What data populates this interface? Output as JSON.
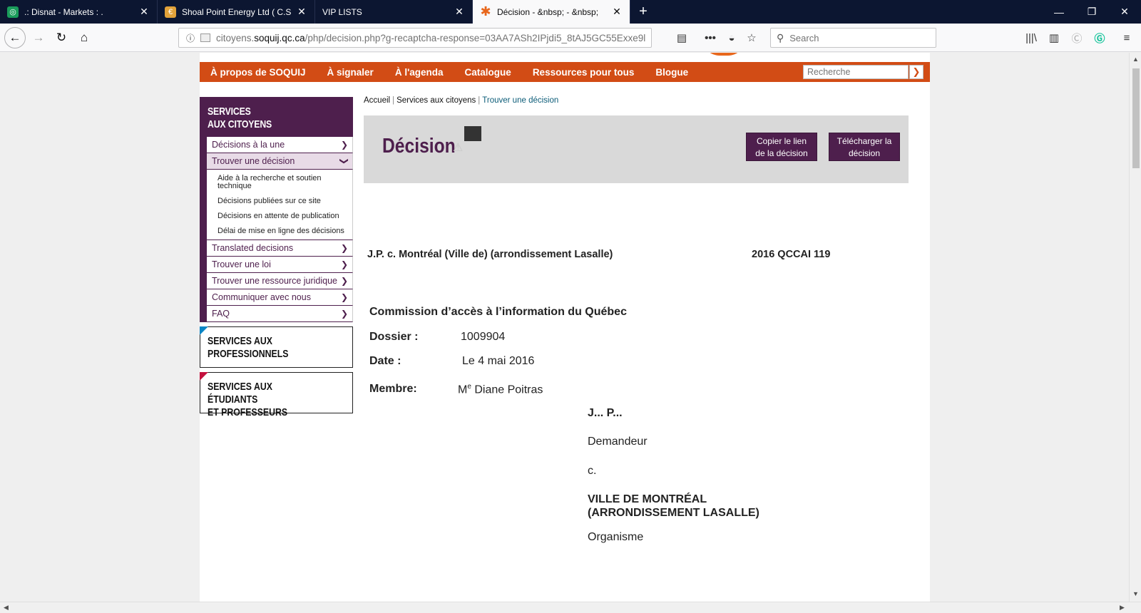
{
  "tabs": [
    {
      "title": ".: Disnat - Markets : .",
      "favicon_color": "#1a9c5b",
      "active": false
    },
    {
      "title": "Shoal Point Energy Ltd ( C.SHP",
      "favicon_color": "#e2a23a",
      "active": false
    },
    {
      "title": "VIP LISTS",
      "favicon_color": "",
      "active": false
    },
    {
      "title": "Décision - &nbsp; - &nbsp;",
      "favicon_color": "#e8671c",
      "active": true
    }
  ],
  "browser": {
    "url_domain": "citoyens.soquij.qc.ca",
    "url_pre": "citoyens.",
    "url_host": "soquij.qc.ca",
    "url_path": "/php/decision.php?g-recaptcha-response=03AA7ASh2IPjdi5_8tAJ5GC55Exxe9l",
    "search_placeholder": "Search"
  },
  "site": {
    "nav": [
      "À propos de SOQUIJ",
      "À signaler",
      "À l'agenda",
      "Catalogue",
      "Ressources pour tous",
      "Blogue"
    ],
    "search_placeholder": "Recherche",
    "accent_color": "#d24c15",
    "brand_color": "#4e1f4d"
  },
  "sidebar": {
    "heading_line1": "SERVICES",
    "heading_line2": "AUX CITOYENS",
    "items_top": [
      {
        "label": "Décisions à la une"
      },
      {
        "label": "Trouver une décision",
        "open": true
      }
    ],
    "subitems": [
      "Aide à la recherche et soutien technique",
      "Décisions publiées sur ce site",
      "Décisions en attente de publication",
      "Délai de mise en ligne des décisions"
    ],
    "items_bottom": [
      {
        "label": "Translated decisions"
      },
      {
        "label": "Trouver une loi"
      },
      {
        "label": "Trouver une ressource juridique"
      },
      {
        "label": "Communiquer avec nous"
      },
      {
        "label": "FAQ"
      }
    ],
    "box_pro_line1": "SERVICES AUX",
    "box_pro_line2": "PROFESSIONNELS",
    "box_etu_line1": "SERVICES AUX ÉTUDIANTS",
    "box_etu_line2": "ET PROFESSEURS"
  },
  "breadcrumb": {
    "home": "Accueil",
    "section": "Services aux citoyens",
    "current": "Trouver une décision"
  },
  "decision": {
    "title": "Décision",
    "copy_line1": "Copier le lien",
    "copy_line2": "de la décision",
    "download_line1": "Télécharger la",
    "download_line2": "décision",
    "case_name": "J.P. c. Montréal (Ville de) (arrondissement Lasalle)",
    "citation": "2016 QCCAI 119",
    "tribunal": "Commission d’accès à l’information du Québec",
    "dossier_label": "Dossier :",
    "dossier_value": "1009904",
    "date_label": "Date :",
    "date_value": "Le 4 mai 2016",
    "membre_label": "Membre:",
    "membre_prefix": "M",
    "membre_sup": "e",
    "membre_name": " Diane Poitras",
    "party1": "J... P...",
    "party1_role": "Demandeur",
    "versus": "c.",
    "party2_line1": "VILLE DE MONTRÉAL",
    "party2_line2": "(ARRONDISSEMENT LASALLE)",
    "party2_role": "Organisme"
  }
}
